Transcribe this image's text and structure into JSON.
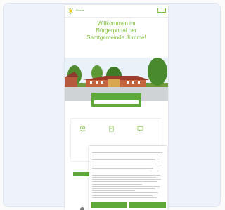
{
  "colors": {
    "brand_green": "#5fa83a",
    "light_green": "#7fbf3f",
    "card_bg": "#eef3fb"
  },
  "nav": {
    "logo_icon": "sun-flower-logo-icon",
    "logo_text": "Jümme",
    "links": [
      "",
      "",
      "",
      "",
      ""
    ],
    "button_label": ""
  },
  "hero": {
    "line1": "Willkommen im",
    "line2": "Bürgerportal der",
    "line3": "Samtgemeinde Jümme!"
  },
  "search": {
    "title": "",
    "placeholder": ""
  },
  "cards": [
    {
      "icon": "people-icon",
      "text": ""
    },
    {
      "icon": "document-icon",
      "text": ""
    },
    {
      "icon": "chat-icon",
      "text": ""
    }
  ],
  "cookie": {
    "title": "",
    "accept_label": "",
    "settings_label": ""
  },
  "bottom": {
    "heading": ""
  }
}
